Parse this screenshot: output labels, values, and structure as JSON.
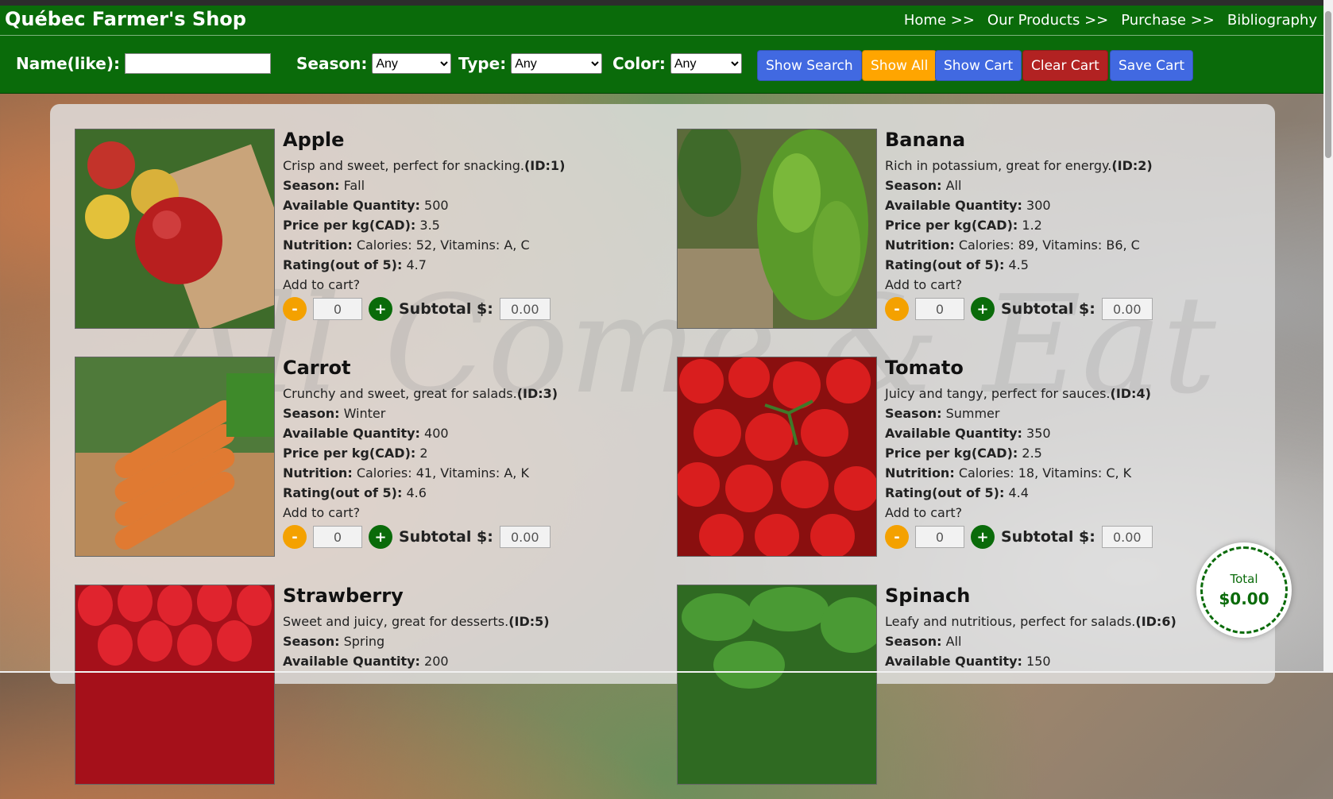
{
  "header": {
    "brand": "Québec Farmer's Shop",
    "nav": [
      "Home >>",
      "Our Products >>",
      "Purchase >>",
      "Bibliography"
    ]
  },
  "search": {
    "name_label": "Name(like):",
    "season_label": "Season:",
    "season_value": "Any",
    "type_label": "Type:",
    "type_value": "Any",
    "color_label": "Color:",
    "color_value": "Any",
    "buttons": {
      "show_search": "Show Search",
      "show_all": "Show All",
      "show_cart": "Show Cart",
      "clear_cart": "Clear Cart",
      "save_cart": "Save Cart"
    },
    "colors": {
      "blue": "#4169e1",
      "orange": "#ffa500",
      "red": "#b22222"
    }
  },
  "watermark": "All Come & Eat",
  "products": [
    {
      "name": "Apple",
      "desc": "Crisp and sweet, perfect for snacking.",
      "id": "(ID:1)",
      "season": "Fall",
      "qty": "500",
      "price": "3.5",
      "nutrition": "Calories: 52, Vitamins: A, C",
      "rating": "4.7",
      "count": "0",
      "subtotal": "0.00",
      "icon": "apple-image"
    },
    {
      "name": "Banana",
      "desc": "Rich in potassium, great for energy.",
      "id": "(ID:2)",
      "season": "All",
      "qty": "300",
      "price": "1.2",
      "nutrition": "Calories: 89, Vitamins: B6, C",
      "rating": "4.5",
      "count": "0",
      "subtotal": "0.00",
      "icon": "banana-image"
    },
    {
      "name": "Carrot",
      "desc": "Crunchy and sweet, great for salads.",
      "id": "(ID:3)",
      "season": "Winter",
      "qty": "400",
      "price": "2",
      "nutrition": "Calories: 41, Vitamins: A, K",
      "rating": "4.6",
      "count": "0",
      "subtotal": "0.00",
      "icon": "carrot-image"
    },
    {
      "name": "Tomato",
      "desc": "Juicy and tangy, perfect for sauces.",
      "id": "(ID:4)",
      "season": "Summer",
      "qty": "350",
      "price": "2.5",
      "nutrition": "Calories: 18, Vitamins: C, K",
      "rating": "4.4",
      "count": "0",
      "subtotal": "0.00",
      "icon": "tomato-image"
    },
    {
      "name": "Strawberry",
      "desc": "Sweet and juicy, great for desserts.",
      "id": "(ID:5)",
      "season": "Spring",
      "qty": "200",
      "icon": "strawberry-image"
    },
    {
      "name": "Spinach",
      "desc": "Leafy and nutritious, perfect for salads.",
      "id": "(ID:6)",
      "season": "All",
      "qty": "150",
      "icon": "spinach-image"
    }
  ],
  "labels": {
    "season": "Season:",
    "qty": "Available Quantity:",
    "price": "Price per kg(CAD):",
    "nutrition": "Nutrition:",
    "rating": "Rating(out of 5):",
    "add": "Add to cart?",
    "subtotal": "Subtotal $:",
    "minus": "-",
    "plus": "+"
  },
  "total": {
    "label": "Total",
    "value": "$0.00"
  }
}
